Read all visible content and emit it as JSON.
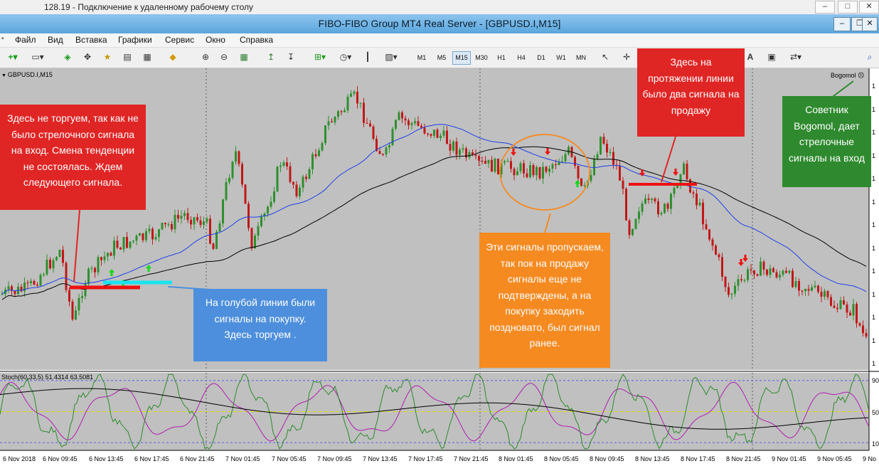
{
  "remote": {
    "title": "128.19 - Подключение к удаленному рабочему столу",
    "min": "–",
    "max": "□",
    "close": "✕"
  },
  "window": {
    "title": "FIBO-FIBO Group MT4 Real Server - [GBPUSD.I,M15]",
    "min": "–",
    "restore": "❐",
    "close": "✕"
  },
  "menu": [
    "Файл",
    "Вид",
    "Вставка",
    "Графики",
    "Сервис",
    "Окно",
    "Справка"
  ],
  "timeframes": [
    "M1",
    "M5",
    "M15",
    "M30",
    "H1",
    "H4",
    "D1",
    "W1",
    "MN"
  ],
  "selected_timeframe": "M15",
  "toolbar_text": {
    "text_tool": "A"
  },
  "chart": {
    "symbol_label": "GBPUSD.I,M15",
    "ea_name": "Bogomol",
    "ea_face": "☹"
  },
  "stoch": {
    "label": "Stoch(60,33,5) 51.4314 63.5081",
    "levels": [
      "90",
      "50",
      "10"
    ]
  },
  "price_ticks": [
    "1",
    "1",
    "1",
    "1",
    "1",
    "1",
    "1",
    "1",
    "1",
    "1",
    "1",
    "1",
    "1"
  ],
  "time_labels": [
    "6 Nov 2018",
    "6 Nov 09:45",
    "6 Nov 13:45",
    "6 Nov 17:45",
    "6 Nov 21:45",
    "7 Nov 01:45",
    "7 Nov 05:45",
    "7 Nov 09:45",
    "7 Nov 13:45",
    "7 Nov 17:45",
    "7 Nov 21:45",
    "8 Nov 01:45",
    "8 Nov 05:45",
    "8 Nov 09:45",
    "8 Nov 13:45",
    "8 Nov 17:45",
    "8 Nov 21:45",
    "9 Nov 01:45",
    "9 Nov 05:45",
    "9 No"
  ],
  "callouts": {
    "left": "Здесь не торгуем, так как не было стрелочного сигнала на вход. Смена тенденции не состоялась. Ждем следующего сигнала.",
    "blue": "На голубой линии были сигналы на покупку. Здесь торгуем .",
    "orange": "Эти сигналы пропускаем, так пок на продажу сигналы еще не подтверждены, а на покупку заходить поздновато, был сигнал ранее.",
    "top": "Здесь на протяжении линии было два сигнала на продажу",
    "green": "Советник Bogomol, дает стрелочные сигналы на вход"
  },
  "colors": {
    "chart_bg": "#c0c0c0",
    "bull": "#2f8f2f",
    "bear": "#c01818",
    "ma_fast": "#1f3fe6",
    "ma_slow": "#000000",
    "stoch_main": "#2c8a2c",
    "stoch_signal": "#b01eb0",
    "signal_buy": "#11d911",
    "signal_sell": "#ee1111"
  },
  "series_seed": 7
}
